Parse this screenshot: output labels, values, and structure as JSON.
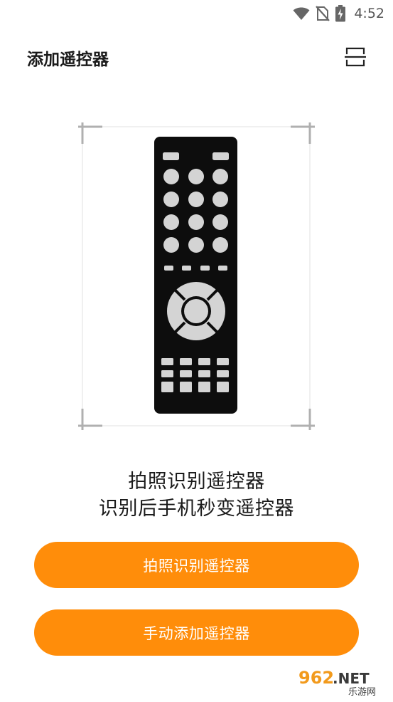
{
  "status_bar": {
    "time": "4:52",
    "icons": [
      "wifi-icon",
      "no-sim-icon",
      "battery-charging-icon"
    ]
  },
  "app_bar": {
    "title": "添加遥控器",
    "action_icon": "scan-frame-icon"
  },
  "illustration": {
    "icon": "remote-control-icon",
    "frame": "scan-viewfinder"
  },
  "caption": {
    "line1": "拍照识别遥控器",
    "line2": "识别后手机秒变遥控器"
  },
  "buttons": {
    "photo_recognize": "拍照识别遥控器",
    "manual_add": "手动添加遥控器"
  },
  "colors": {
    "accent": "#ff8d0a",
    "remote_body": "#0d0d0d",
    "remote_keys": "#d4d4d4"
  },
  "watermark": {
    "brand": "962.NET",
    "subtitle": "乐游网"
  }
}
